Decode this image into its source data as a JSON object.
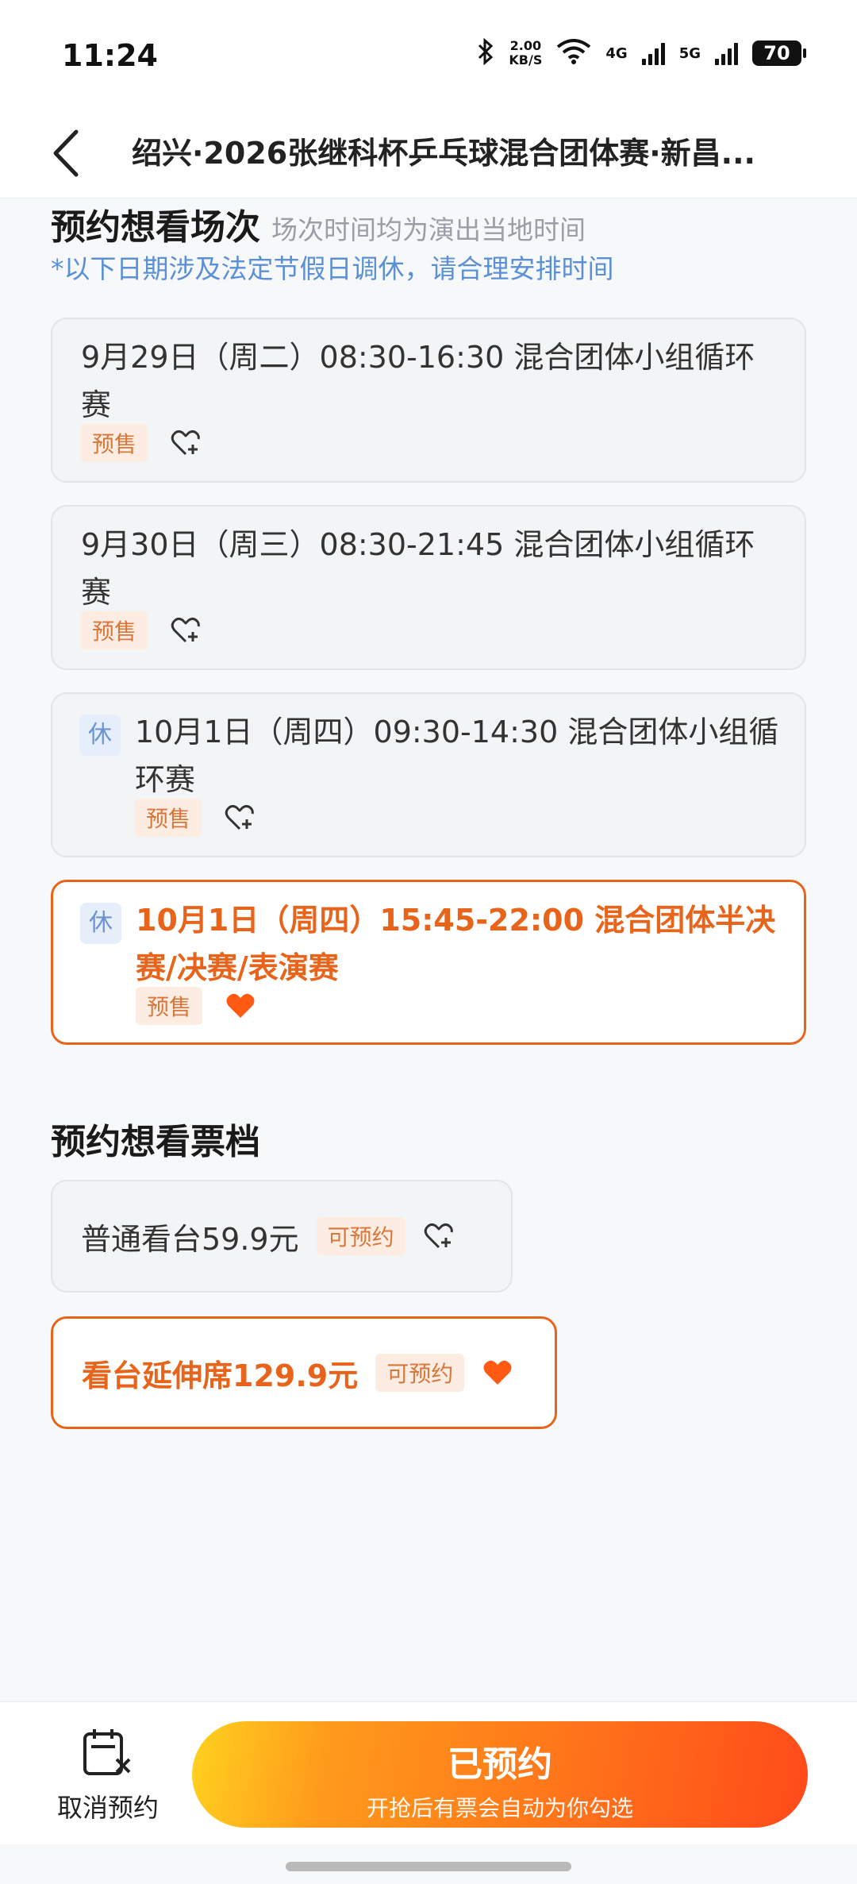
{
  "status": {
    "time": "11:24",
    "speed_top": "2.00",
    "speed_bottom": "KB/S",
    "net1": "4G",
    "net2": "5G",
    "battery": "70"
  },
  "nav": {
    "title": "绍兴·2026张继科杯乒乓球混合团体赛·新昌..."
  },
  "sessions": {
    "heading": "预约想看场次",
    "sub": "场次时间均为演出当地时间",
    "notice": "*以下日期涉及法定节假日调休，请合理安排时间",
    "items": [
      {
        "text": "9月29日（周二）08:30-16:30 混合团体小组循环赛",
        "tag": "预售",
        "rest": "",
        "selected": false
      },
      {
        "text": "9月30日（周三）08:30-21:45 混合团体小组循环赛",
        "tag": "预售",
        "rest": "",
        "selected": false
      },
      {
        "text": "10月1日（周四）09:30-14:30 混合团体小组循环赛",
        "tag": "预售",
        "rest": "休",
        "selected": false
      },
      {
        "text": "10月1日（周四）15:45-22:00 混合团体半决赛/决赛/表演赛",
        "tag": "预售",
        "rest": "休",
        "selected": true
      }
    ]
  },
  "tickets": {
    "heading": "预约想看票档",
    "items": [
      {
        "name": "普通看台59.9元",
        "tag": "可预约",
        "selected": false
      },
      {
        "name": "看台延伸席129.9元",
        "tag": "可预约",
        "selected": true
      }
    ]
  },
  "bottom": {
    "cancel_label": "取消预约",
    "cta_main": "已预约",
    "cta_sub": "开抢后有票会自动为你勾选"
  },
  "colors": {
    "accent": "#e8641b",
    "notice": "#5b8fd6",
    "tag_bg": "#fdece1"
  }
}
